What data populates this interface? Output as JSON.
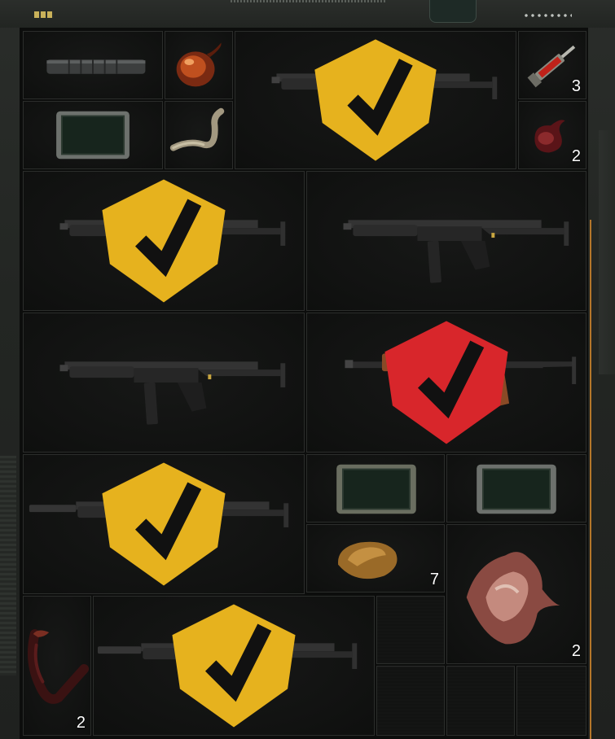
{
  "inventory": {
    "items": [
      {
        "id": "silencer",
        "name": "suppressor-item",
        "qty": ""
      },
      {
        "id": "amber-organ",
        "name": "amber-organ-item",
        "qty": ""
      },
      {
        "id": "tablet-1",
        "name": "tablet-item",
        "qty": ""
      },
      {
        "id": "worm",
        "name": "worm-item",
        "qty": ""
      },
      {
        "id": "smg-1",
        "name": "smg-weapon",
        "qty": "",
        "badge": "gold"
      },
      {
        "id": "syringe",
        "name": "syringe-item",
        "qty": "3"
      },
      {
        "id": "flesh-sac",
        "name": "flesh-sac-item",
        "qty": "2"
      },
      {
        "id": "smg-2",
        "name": "smg-weapon",
        "qty": "",
        "badge": "gold"
      },
      {
        "id": "smg-3",
        "name": "smg-weapon",
        "qty": ""
      },
      {
        "id": "smg-4",
        "name": "smg-weapon",
        "qty": ""
      },
      {
        "id": "ak",
        "name": "ak-rifle-weapon",
        "qty": "",
        "badge": "red"
      },
      {
        "id": "smg-5",
        "name": "smg-suppressed-weapon",
        "qty": "",
        "badge": "gold"
      },
      {
        "id": "tablet-2",
        "name": "tablet-item",
        "qty": ""
      },
      {
        "id": "tablet-3",
        "name": "tablet-item",
        "qty": ""
      },
      {
        "id": "stone",
        "name": "stone-item",
        "qty": "7"
      },
      {
        "id": "pelt",
        "name": "pelt-item",
        "qty": "2"
      },
      {
        "id": "tentacle",
        "name": "tentacle-item",
        "qty": "2"
      },
      {
        "id": "smg-6",
        "name": "smg-scoped-weapon",
        "qty": "",
        "badge": "gold"
      }
    ]
  },
  "colors": {
    "gold_badge": "#e6b21e",
    "red_badge": "#d8262b",
    "accent_line": "#b5772a"
  }
}
